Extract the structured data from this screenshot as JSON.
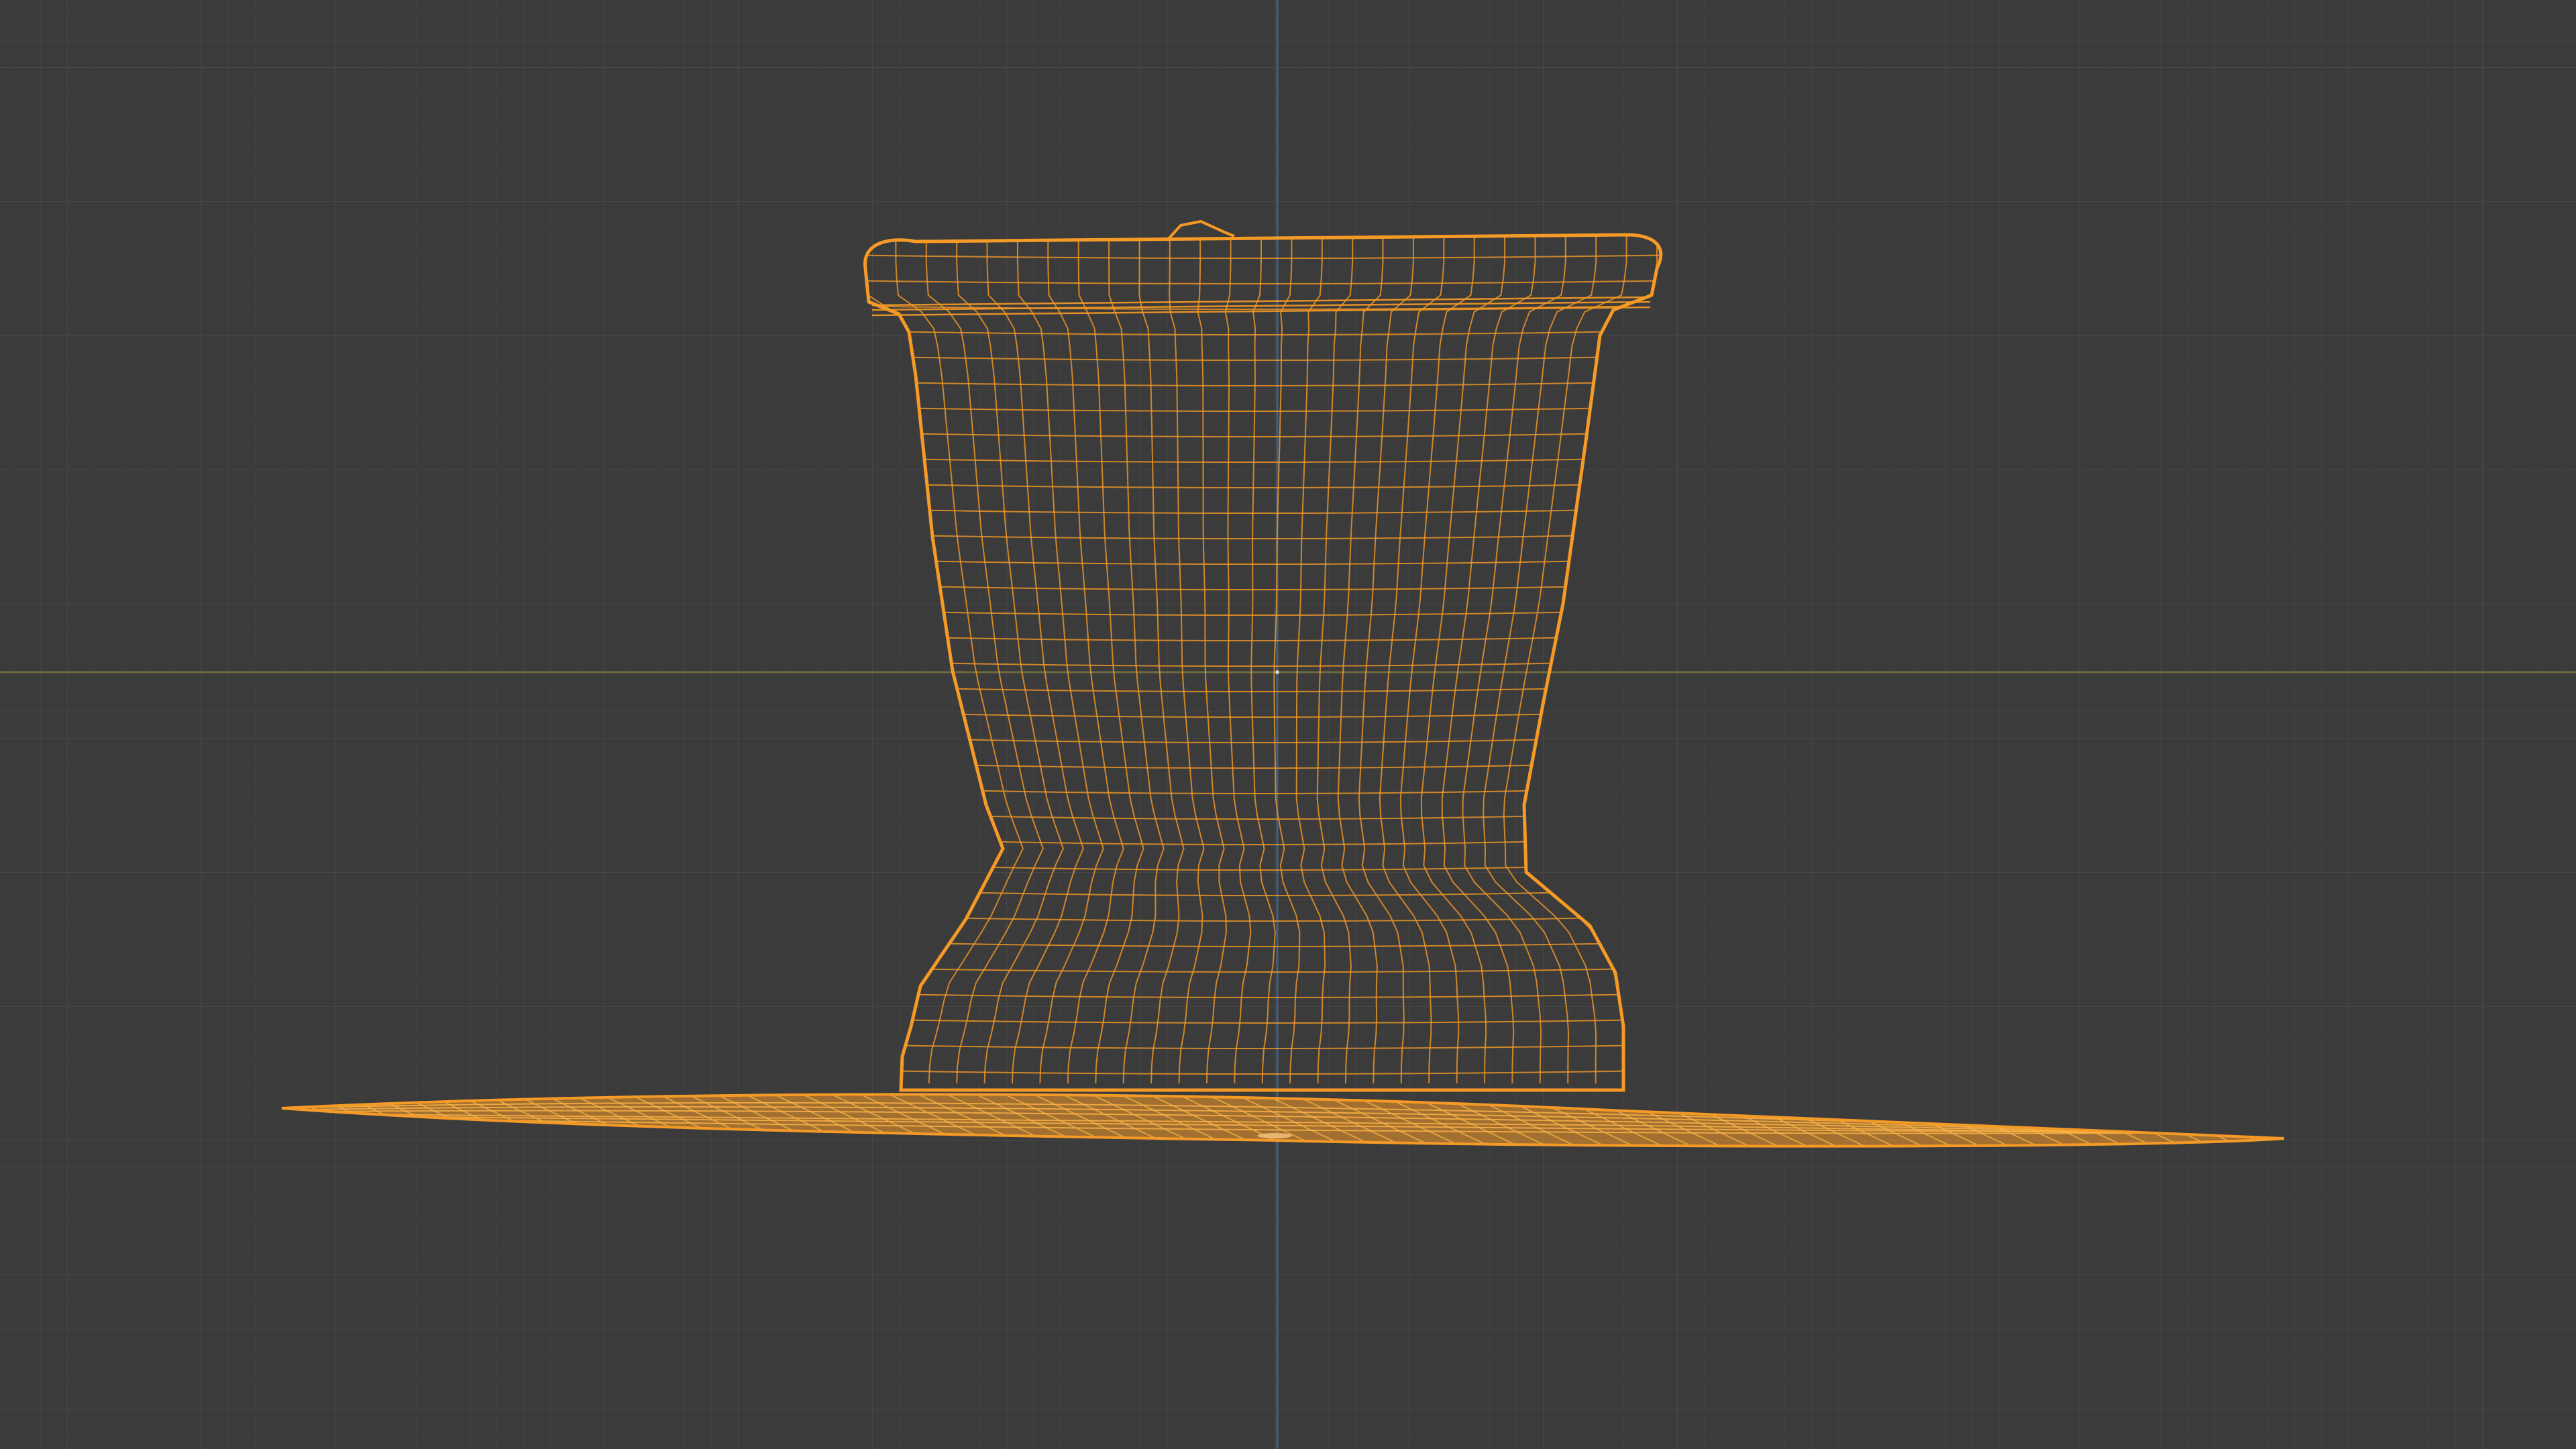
{
  "viewport": {
    "background_color": "#3b3b3b",
    "grid": true,
    "grid_color": "#444444",
    "x_axis_color": "#7d7a43",
    "y_axis_color": "#4e6a8f",
    "selection_color": "#f59a26",
    "view_mode": "wireframe",
    "object_selected": true
  }
}
